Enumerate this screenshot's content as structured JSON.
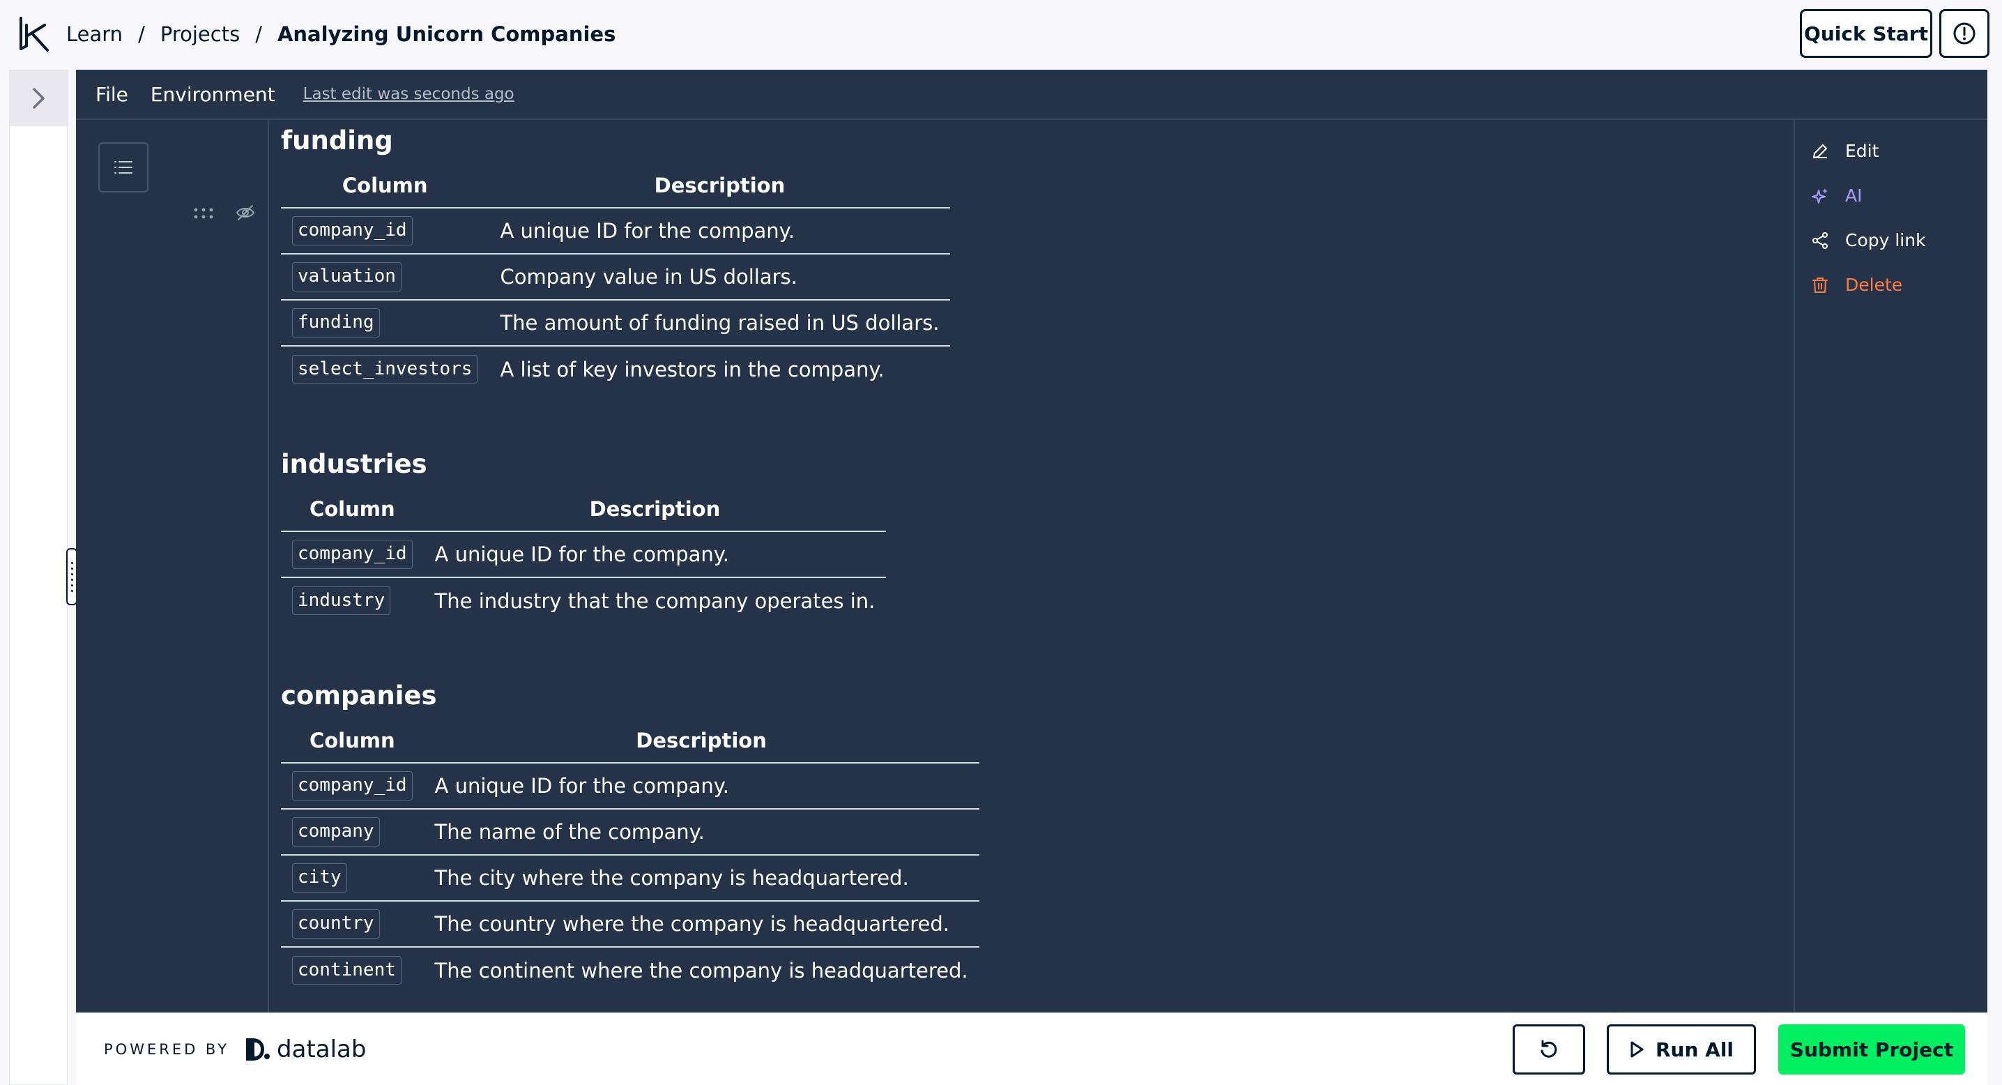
{
  "breadcrumb": {
    "items": [
      "Learn",
      "Projects"
    ],
    "current": "Analyzing Unicorn Companies",
    "separator": "/"
  },
  "header": {
    "quick_start_label": "Quick Start",
    "info_icon": "info-circle-icon"
  },
  "menu": {
    "file": "File",
    "environment": "Environment",
    "last_edit": "Last edit was seconds ago"
  },
  "sections": [
    {
      "title": "funding",
      "headers": [
        "Column",
        "Description"
      ],
      "rows": [
        [
          "company_id",
          "A unique ID for the company."
        ],
        [
          "valuation",
          "Company value in US dollars."
        ],
        [
          "funding",
          "The amount of funding raised in US dollars."
        ],
        [
          "select_investors",
          "A list of key investors in the company."
        ]
      ]
    },
    {
      "title": "industries",
      "headers": [
        "Column",
        "Description"
      ],
      "rows": [
        [
          "company_id",
          "A unique ID for the company."
        ],
        [
          "industry",
          "The industry that the company operates in."
        ]
      ]
    },
    {
      "title": "companies",
      "headers": [
        "Column",
        "Description"
      ],
      "rows": [
        [
          "company_id",
          "A unique ID for the company."
        ],
        [
          "company",
          "The name of the company."
        ],
        [
          "city",
          "The city where the company is headquartered."
        ],
        [
          "country",
          "The country where the company is headquartered."
        ],
        [
          "continent",
          "The continent where the company is headquartered."
        ]
      ]
    }
  ],
  "cell_actions": {
    "edit": "Edit",
    "ai": "AI",
    "copy_link": "Copy link",
    "delete": "Delete"
  },
  "footer": {
    "powered_by": "POWERED BY",
    "brand": "datalab",
    "run_all": "Run All",
    "submit": "Submit Project"
  },
  "colors": {
    "workspace_bg": "#253348",
    "accent_green": "#03ef62",
    "ai_purple": "#a99cff",
    "delete_orange": "#ff7a45",
    "navy": "#05192d"
  }
}
